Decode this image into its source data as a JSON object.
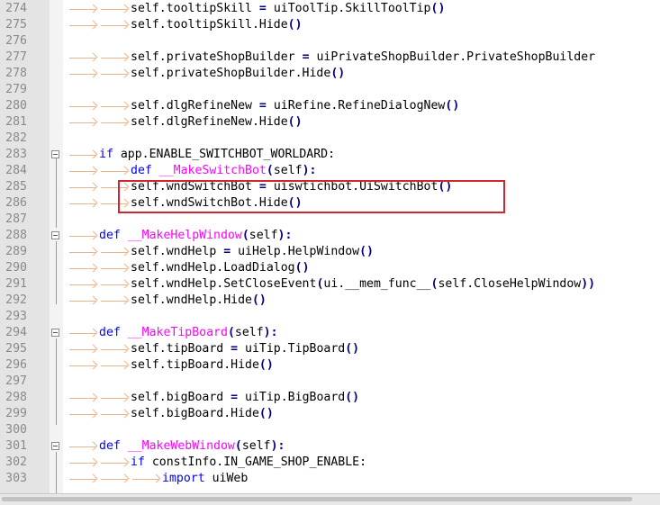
{
  "editor": {
    "lines": [
      {
        "no": "274",
        "indent": 2,
        "tokens": [
          {
            "t": "self.tooltipSkill "
          },
          {
            "t": "=",
            "c": "op"
          },
          {
            "t": " uiToolTip.SkillToolTip"
          },
          {
            "t": "()",
            "c": "op"
          }
        ]
      },
      {
        "no": "275",
        "indent": 2,
        "tokens": [
          {
            "t": "self.tooltipSkill.Hide"
          },
          {
            "t": "()",
            "c": "op"
          }
        ]
      },
      {
        "no": "276",
        "indent": 0,
        "tokens": []
      },
      {
        "no": "277",
        "indent": 2,
        "tokens": [
          {
            "t": "self.privateShopBuilder "
          },
          {
            "t": "=",
            "c": "op"
          },
          {
            "t": " uiPrivateShopBuilder.PrivateShopBuilder"
          }
        ]
      },
      {
        "no": "278",
        "indent": 2,
        "tokens": [
          {
            "t": "self.privateShopBuilder.Hide"
          },
          {
            "t": "()",
            "c": "op"
          }
        ]
      },
      {
        "no": "279",
        "indent": 0,
        "tokens": []
      },
      {
        "no": "280",
        "indent": 2,
        "tokens": [
          {
            "t": "self.dlgRefineNew "
          },
          {
            "t": "=",
            "c": "op"
          },
          {
            "t": " uiRefine.RefineDialogNew"
          },
          {
            "t": "()",
            "c": "op"
          }
        ]
      },
      {
        "no": "281",
        "indent": 2,
        "tokens": [
          {
            "t": "self.dlgRefineNew.Hide"
          },
          {
            "t": "()",
            "c": "op"
          }
        ]
      },
      {
        "no": "282",
        "indent": 0,
        "tokens": []
      },
      {
        "no": "283",
        "indent": 1,
        "fold": true,
        "tokens": [
          {
            "t": "if",
            "c": "kw"
          },
          {
            "t": " app.ENABLE_SWITCHBOT_WORLDARD:"
          }
        ]
      },
      {
        "no": "284",
        "indent": 2,
        "tokens": [
          {
            "t": "def",
            "c": "kw"
          },
          {
            "t": " "
          },
          {
            "t": "__MakeSwitchBot",
            "c": "fn"
          },
          {
            "t": "(",
            "c": "op"
          },
          {
            "t": "self"
          },
          {
            "t": "):",
            "c": "op"
          }
        ]
      },
      {
        "no": "285",
        "indent": 2,
        "tokens": [
          {
            "t": "self.wndSwitchBot "
          },
          {
            "t": "=",
            "c": "op"
          },
          {
            "t": " uiswtichbot.UiSwitchBot"
          },
          {
            "t": "()",
            "c": "op"
          }
        ]
      },
      {
        "no": "286",
        "indent": 2,
        "tokens": [
          {
            "t": "self.wndSwitchBot.Hide"
          },
          {
            "t": "()",
            "c": "op"
          }
        ]
      },
      {
        "no": "287",
        "indent": 0,
        "tokens": []
      },
      {
        "no": "288",
        "indent": 1,
        "fold": true,
        "tokens": [
          {
            "t": "def",
            "c": "kw"
          },
          {
            "t": " "
          },
          {
            "t": "__MakeHelpWindow",
            "c": "fn"
          },
          {
            "t": "(",
            "c": "op"
          },
          {
            "t": "self"
          },
          {
            "t": "):",
            "c": "op"
          }
        ]
      },
      {
        "no": "289",
        "indent": 2,
        "tokens": [
          {
            "t": "self.wndHelp "
          },
          {
            "t": "=",
            "c": "op"
          },
          {
            "t": " uiHelp.HelpWindow"
          },
          {
            "t": "()",
            "c": "op"
          }
        ]
      },
      {
        "no": "290",
        "indent": 2,
        "tokens": [
          {
            "t": "self.wndHelp.LoadDialog"
          },
          {
            "t": "()",
            "c": "op"
          }
        ]
      },
      {
        "no": "291",
        "indent": 2,
        "tokens": [
          {
            "t": "self.wndHelp.SetCloseEvent"
          },
          {
            "t": "(",
            "c": "op"
          },
          {
            "t": "ui.__mem_func__"
          },
          {
            "t": "(",
            "c": "op"
          },
          {
            "t": "self.CloseHelpWindow"
          },
          {
            "t": "))",
            "c": "op"
          }
        ]
      },
      {
        "no": "292",
        "indent": 2,
        "tokens": [
          {
            "t": "self.wndHelp.Hide"
          },
          {
            "t": "()",
            "c": "op"
          }
        ]
      },
      {
        "no": "293",
        "indent": 0,
        "tokens": []
      },
      {
        "no": "294",
        "indent": 1,
        "fold": true,
        "tokens": [
          {
            "t": "def",
            "c": "kw"
          },
          {
            "t": " "
          },
          {
            "t": "__MakeTipBoard",
            "c": "fn"
          },
          {
            "t": "(",
            "c": "op"
          },
          {
            "t": "self"
          },
          {
            "t": "):",
            "c": "op"
          }
        ]
      },
      {
        "no": "295",
        "indent": 2,
        "tokens": [
          {
            "t": "self.tipBoard "
          },
          {
            "t": "=",
            "c": "op"
          },
          {
            "t": " uiTip.TipBoard"
          },
          {
            "t": "()",
            "c": "op"
          }
        ]
      },
      {
        "no": "296",
        "indent": 2,
        "tokens": [
          {
            "t": "self.tipBoard.Hide"
          },
          {
            "t": "()",
            "c": "op"
          }
        ]
      },
      {
        "no": "297",
        "indent": 0,
        "tokens": []
      },
      {
        "no": "298",
        "indent": 2,
        "tokens": [
          {
            "t": "self.bigBoard "
          },
          {
            "t": "=",
            "c": "op"
          },
          {
            "t": " uiTip.BigBoard"
          },
          {
            "t": "()",
            "c": "op"
          }
        ]
      },
      {
        "no": "299",
        "indent": 2,
        "tokens": [
          {
            "t": "self.bigBoard.Hide"
          },
          {
            "t": "()",
            "c": "op"
          }
        ]
      },
      {
        "no": "300",
        "indent": 0,
        "tokens": []
      },
      {
        "no": "301",
        "indent": 1,
        "fold": true,
        "tokens": [
          {
            "t": "def",
            "c": "kw"
          },
          {
            "t": " "
          },
          {
            "t": "__MakeWebWindow",
            "c": "fn"
          },
          {
            "t": "(",
            "c": "op"
          },
          {
            "t": "self"
          },
          {
            "t": "):",
            "c": "op"
          }
        ]
      },
      {
        "no": "302",
        "indent": 2,
        "tokens": [
          {
            "t": "if",
            "c": "kw"
          },
          {
            "t": " constInfo.IN_GAME_SHOP_ENABLE:"
          }
        ]
      },
      {
        "no": "303",
        "indent": 3,
        "tokens": [
          {
            "t": "import",
            "c": "kw"
          },
          {
            "t": " uiWeb"
          }
        ]
      }
    ]
  },
  "highlight_color": "#d0272e"
}
